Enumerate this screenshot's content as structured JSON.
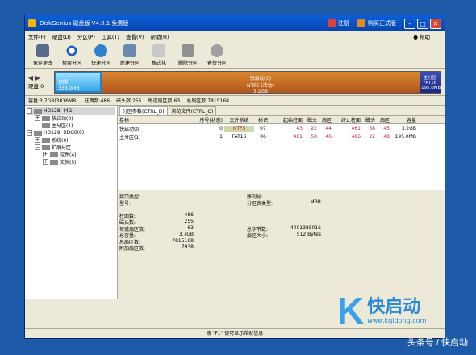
{
  "window": {
    "title": "DiskGenius 磁盘版 V4.0.1 免费版",
    "register_label": "注册",
    "buy_label": "购买正式版"
  },
  "menu": {
    "items": [
      "文件(F)",
      "硬盘(D)",
      "分区(P)",
      "工具(T)",
      "查看(V)",
      "帮助(H)"
    ],
    "help": "帮助"
  },
  "toolbar": {
    "items": [
      "保存更改",
      "搜索分区",
      "快速分区",
      "新建分区",
      "格式化",
      "删除分区",
      "备份分区"
    ]
  },
  "disk": {
    "label": "硬盘 0",
    "seg1": {
      "name": "快照",
      "size": "338.0MB"
    },
    "seg2": {
      "name": "快启动(0)",
      "fs": "NTFS (活动)",
      "size": "3.2GB"
    },
    "seg3": {
      "name": "主分区",
      "fs": "FAT16",
      "size": "195.0MB"
    }
  },
  "info_line": [
    "容量:3.7GB(3816MB)",
    "柱面数:486",
    "磁头数:255",
    "每道扇区数:63",
    "总扇区数:7815168"
  ],
  "tree": [
    {
      "depth": 0,
      "pm": "−",
      "label": "HD128: (4G)",
      "selected": true
    },
    {
      "depth": 1,
      "pm": "+",
      "label": "快启动(0)"
    },
    {
      "depth": 1,
      "pm": "",
      "label": "主分区(1)"
    },
    {
      "depth": 0,
      "pm": "−",
      "label": "HD129: XDG0(0)"
    },
    {
      "depth": 1,
      "pm": "+",
      "label": "系统(0)"
    },
    {
      "depth": 1,
      "pm": "−",
      "label": "扩展分区"
    },
    {
      "depth": 2,
      "pm": "+",
      "label": "软件(4)"
    },
    {
      "depth": 2,
      "pm": "+",
      "label": "文档(5)"
    }
  ],
  "tabs": [
    "分区参数(CTRL_D)",
    "浏览文件(CTRL_G)"
  ],
  "table": {
    "headers": [
      "卷标",
      "序号(状态)",
      "文件系统",
      "标识",
      "起始柱面",
      "磁头",
      "扇区",
      "终止柱面",
      "磁头",
      "扇区",
      "容量"
    ],
    "rows": [
      [
        "快启动(0)",
        "0",
        "NTFS",
        "07",
        "43",
        "22",
        "44",
        "461",
        "58",
        "45",
        "3.2GB"
      ],
      [
        "主分区(1)",
        "1",
        "FAT16",
        "06",
        "461",
        "58",
        "46",
        "486",
        "22",
        "48",
        "195.0MB"
      ]
    ]
  },
  "details": {
    "left_top": [
      [
        "接口类型:",
        ""
      ],
      [
        "型号:",
        ""
      ]
    ],
    "right_top": [
      [
        "序列号:",
        ""
      ],
      [
        "分区表类型:",
        "MBR"
      ]
    ],
    "left": [
      [
        "柱面数:",
        "486"
      ],
      [
        "磁头数:",
        "255"
      ],
      [
        "每道扇区数:",
        "63"
      ],
      [
        "总容量:",
        "3.7GB"
      ],
      [
        "总扇区数:",
        "7815168"
      ],
      [
        "附加扇区数:",
        "7938"
      ]
    ],
    "right": [
      [
        "总字节数:",
        "4001385016"
      ],
      [
        "扇区大小:",
        "512 Bytes"
      ]
    ]
  },
  "statusbar": "按 \"F1\" 键可显示帮助信息",
  "watermark": {
    "letter": "K",
    "brand": "快启动",
    "url": "www.kqidong.com"
  },
  "toutiao": "头条号 / 快启动"
}
